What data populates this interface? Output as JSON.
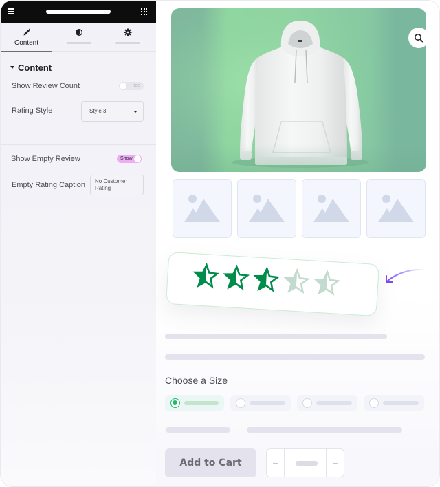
{
  "sidebar": {
    "topbar": {
      "menu_icon": "hamburger-icon",
      "apps_icon": "grid-icon"
    },
    "tabs": [
      {
        "label": "Content",
        "icon": "pencil-icon",
        "active": true
      },
      {
        "label": "",
        "icon": "half-circle-style-icon",
        "active": false
      },
      {
        "label": "",
        "icon": "gear-icon",
        "active": false
      }
    ],
    "section_title": "Content",
    "controls": {
      "show_review_count": {
        "label": "Show Review Count",
        "toggle_text": "Hide",
        "on": false
      },
      "rating_style": {
        "label": "Rating Style",
        "value": "Style 3"
      },
      "show_empty_review": {
        "label": "Show Empty Review",
        "toggle_text": "Show",
        "on": true
      },
      "empty_rating_caption": {
        "label": "Empty Rating Caption",
        "value": "No Customer Rating"
      }
    }
  },
  "preview": {
    "product_image": "white-hoodie-on-green-background",
    "zoom_icon": "magnifier-icon",
    "thumbnails": [
      "image-placeholder",
      "image-placeholder",
      "image-placeholder",
      "image-placeholder"
    ],
    "rating": {
      "style": "half-filled-outline-stars",
      "active_count": 3,
      "total": 5,
      "active_color": "#008c4a",
      "inactive_color": "#c3dbcf"
    },
    "size_section_title": "Choose a Size",
    "size_options_selected_index": 0,
    "size_option_count": 4,
    "add_to_cart_label": "Add to Cart",
    "qty_minus": "−",
    "qty_plus": "+",
    "accent_colors": {
      "toggle_on": "#ecadf3",
      "selected_radio": "#22b96c",
      "arrow": "#7b4cf2"
    }
  }
}
